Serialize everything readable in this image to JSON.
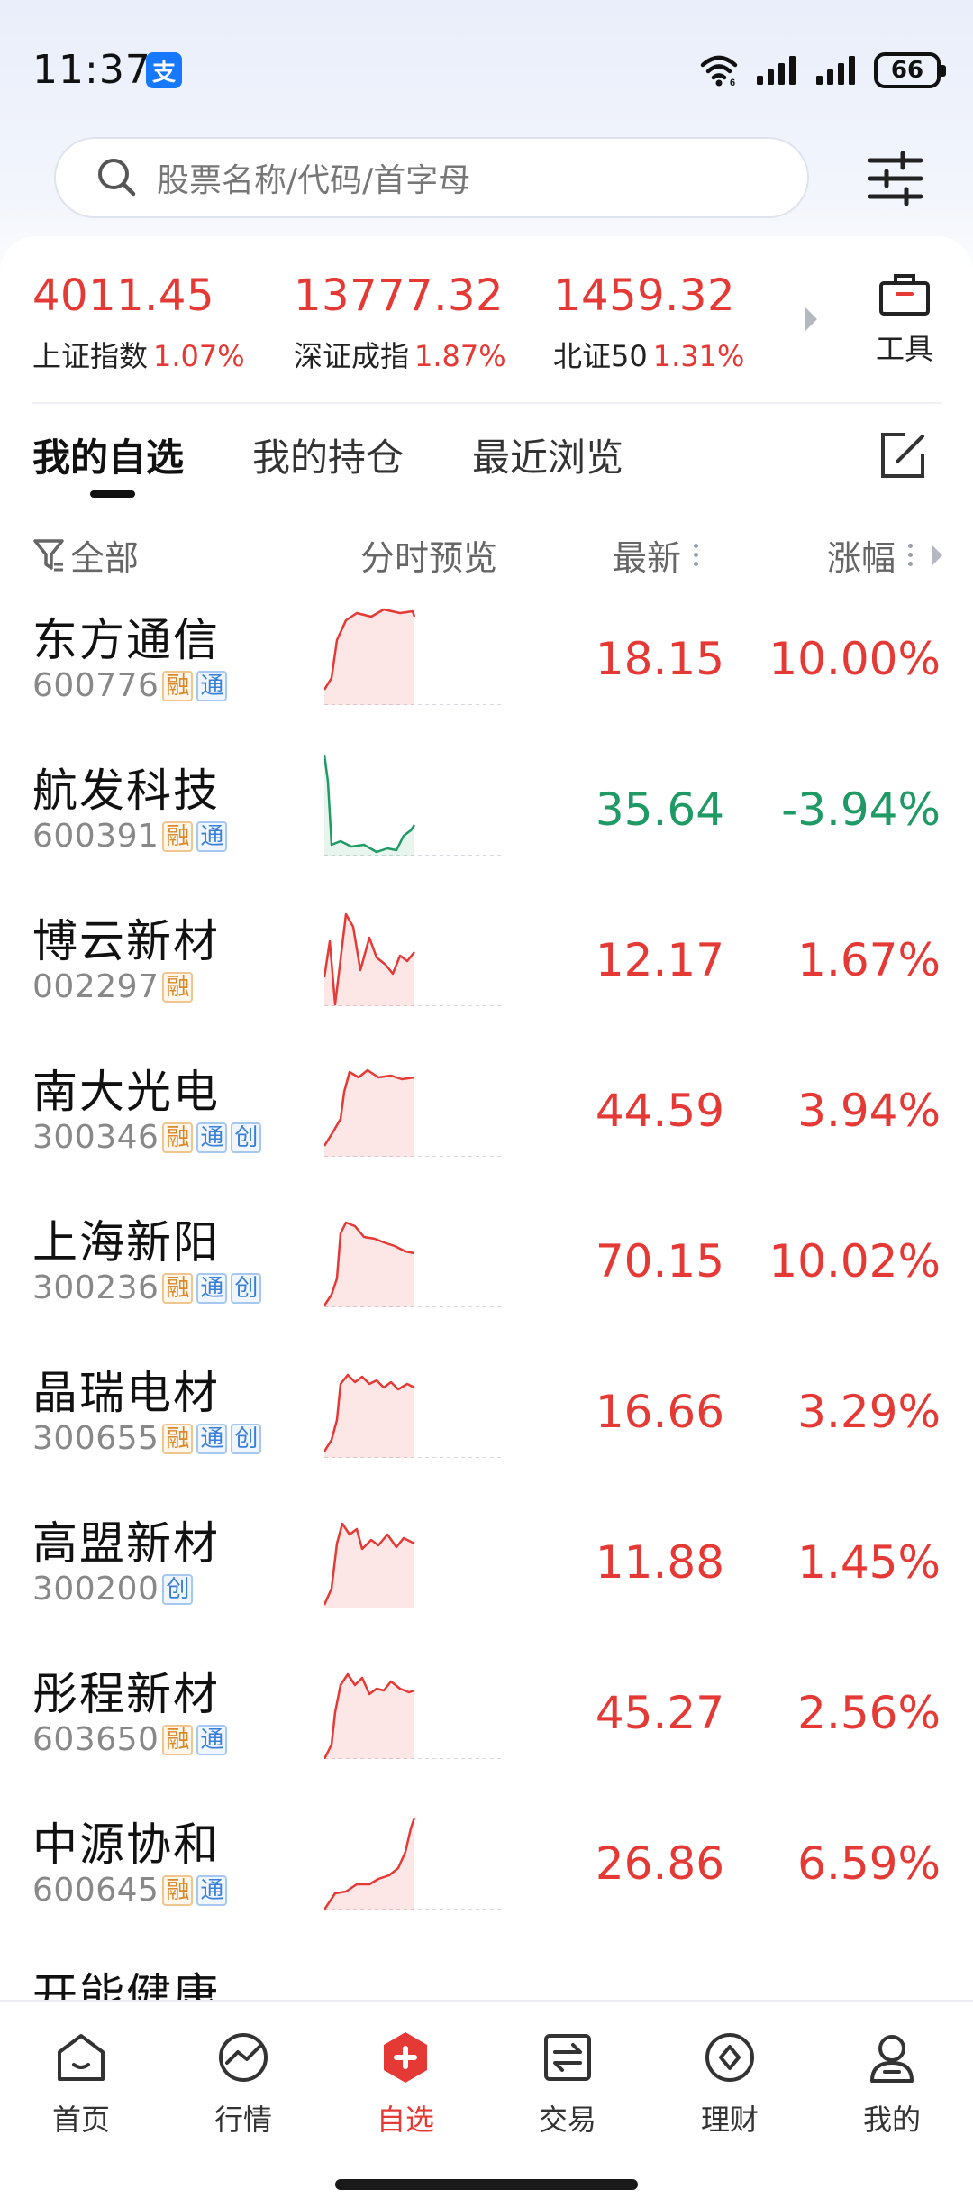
{
  "status_bar": {
    "time": "11:37",
    "app_badge": "支",
    "battery": "66"
  },
  "search": {
    "placeholder": "股票名称/代码/首字母"
  },
  "indices": [
    {
      "value": "4011.45",
      "name": "上证指数",
      "change": "1.07%"
    },
    {
      "value": "13777.32",
      "name": "深证成指",
      "change": "1.87%"
    },
    {
      "value": "1459.32",
      "name": "北证50",
      "change": "1.31%"
    }
  ],
  "tools_label": "工具",
  "tabs": [
    {
      "label": "我的自选",
      "active": true
    },
    {
      "label": "我的持仓",
      "active": false
    },
    {
      "label": "最近浏览",
      "active": false
    }
  ],
  "columns": {
    "filter": "全部",
    "preview": "分时预览",
    "latest": "最新",
    "change": "涨幅"
  },
  "stocks": [
    {
      "name": "东方通信",
      "code": "600776",
      "tags": [
        "融",
        "通"
      ],
      "price": "18.15",
      "change": "10.00%",
      "direction": "up"
    },
    {
      "name": "航发科技",
      "code": "600391",
      "tags": [
        "融",
        "通"
      ],
      "price": "35.64",
      "change": "-3.94%",
      "direction": "down"
    },
    {
      "name": "博云新材",
      "code": "002297",
      "tags": [
        "融"
      ],
      "price": "12.17",
      "change": "1.67%",
      "direction": "up"
    },
    {
      "name": "南大光电",
      "code": "300346",
      "tags": [
        "融",
        "通",
        "创"
      ],
      "price": "44.59",
      "change": "3.94%",
      "direction": "up"
    },
    {
      "name": "上海新阳",
      "code": "300236",
      "tags": [
        "融",
        "通",
        "创"
      ],
      "price": "70.15",
      "change": "10.02%",
      "direction": "up"
    },
    {
      "name": "晶瑞电材",
      "code": "300655",
      "tags": [
        "融",
        "通",
        "创"
      ],
      "price": "16.66",
      "change": "3.29%",
      "direction": "up"
    },
    {
      "name": "高盟新材",
      "code": "300200",
      "tags": [
        "创"
      ],
      "price": "11.88",
      "change": "1.45%",
      "direction": "up"
    },
    {
      "name": "彤程新材",
      "code": "603650",
      "tags": [
        "融",
        "通"
      ],
      "price": "45.27",
      "change": "2.56%",
      "direction": "up"
    },
    {
      "name": "中源协和",
      "code": "600645",
      "tags": [
        "融",
        "通"
      ],
      "price": "26.86",
      "change": "6.59%",
      "direction": "up"
    },
    {
      "name": "开能健康",
      "code": "",
      "tags": [],
      "price": "",
      "change": "",
      "direction": "up"
    }
  ],
  "colors": {
    "up": "#e53935",
    "down": "#1f9a64",
    "active_tab": "#e53935"
  },
  "bottom_nav": [
    {
      "label": "首页",
      "icon": "home-icon"
    },
    {
      "label": "行情",
      "icon": "market-icon"
    },
    {
      "label": "自选",
      "icon": "watchlist-icon",
      "active": true
    },
    {
      "label": "交易",
      "icon": "trade-icon"
    },
    {
      "label": "理财",
      "icon": "wealth-icon"
    },
    {
      "label": "我的",
      "icon": "profile-icon"
    }
  ]
}
